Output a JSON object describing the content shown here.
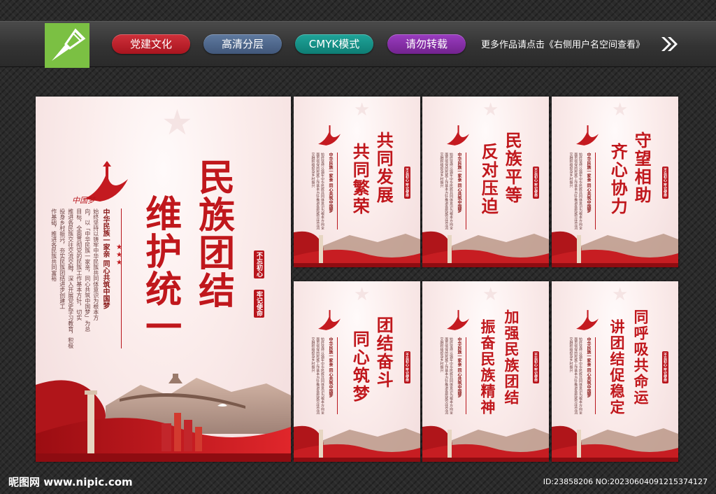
{
  "toolbar": {
    "tags": [
      "党建文化",
      "高清分层",
      "CMYK模式",
      "请勿转载"
    ],
    "more_text": "更多作品请点击《右侧用户名空间查看》",
    "arrow_icon": "double-chevron-right-icon",
    "logo_icon": "pen-nib-logo-icon"
  },
  "main_poster": {
    "title_line1": "民族团结",
    "title_line2": "维护统一",
    "emblem_text": "中国梦",
    "subtitle": "中华民族一家亲 同心共筑中国梦",
    "body_lines": [
      "始终坚持以铸牢中华民族共同体意识为根本方",
      "向，以「中华民族一家亲，同心共筑中国梦」为总",
      "目标，全面贯彻党的民族工作基本方针，切实",
      "推进各民族交往交流交融，深入开展党史学习教育，积极",
      "投身乡村振兴，夯实民族团结进步创建工",
      "作基础，推进各民族共同富裕"
    ],
    "seal_1": "不忘初心",
    "seal_2": "牢记使命"
  },
  "small_posters": [
    {
      "title_1": "共同发展",
      "title_2": "共同繁荣"
    },
    {
      "title_1": "民族平等",
      "title_2": "反对压迫"
    },
    {
      "title_1": "守望相助",
      "title_2": "齐心协力"
    },
    {
      "title_1": "团结奋斗",
      "title_2": "同心筑梦"
    },
    {
      "title_1": "加强民族团结",
      "title_2": "振奋民族精神"
    },
    {
      "title_1": "同呼吸共命运",
      "title_2": "讲团结促稳定"
    }
  ],
  "small_common": {
    "emblem_text": "中国梦",
    "subtitle": "中华民族一家亲 同心共筑中国梦",
    "body_text": "始终坚持以铸牢中华民族共同体意识为根本方向全面贯彻党的民族工作基本方针推进各民族交往交流交融积极投身乡村振兴",
    "seal_text": "不忘初心 牢记使命"
  },
  "footer": {
    "site": "昵图网 www.nipic.com",
    "id_text": "ID:23858206 NO:20230604091215374127"
  },
  "colors": {
    "brand_red": "#c0171c",
    "tag_red": "#c0242d",
    "tag_blue": "#4f6689",
    "tag_teal": "#15918a",
    "tag_purple": "#872fa6",
    "logo_green": "#7bc043"
  }
}
